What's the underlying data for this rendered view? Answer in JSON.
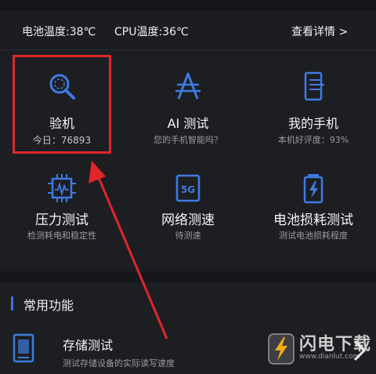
{
  "status": {
    "battery_temp": "电池温度:38℃",
    "cpu_temp": "CPU温度:36℃",
    "details_link": "查看详情 >"
  },
  "features": [
    {
      "title": "验机",
      "sub": "今日：76893",
      "icon": "search-magnifier-icon"
    },
    {
      "title": "AI 测试",
      "sub": "您的手机智能吗？",
      "icon": "ai-letter-icon"
    },
    {
      "title": "我的手机",
      "sub": "本机好评度：93%",
      "icon": "phone-info-icon"
    },
    {
      "title": "压力测试",
      "sub": "检测耗电和稳定性",
      "icon": "chip-icon"
    },
    {
      "title": "网络测速",
      "sub": "待测速",
      "icon": "5g-icon"
    },
    {
      "title": "电池损耗测试",
      "sub": "测试电池损耗程度",
      "icon": "battery-charging-icon"
    }
  ],
  "common": {
    "section_title": "常用功能",
    "items": [
      {
        "label": "存储测试",
        "desc": "测试存储设备的实际读写速度",
        "icon": "storage-card-icon"
      }
    ]
  },
  "watermark": {
    "name": "闪电下载",
    "url": "www.dianlut.com"
  },
  "colors": {
    "accent": "#3d6fd6",
    "highlight": "#e0262a",
    "background": "#1d1e22"
  }
}
